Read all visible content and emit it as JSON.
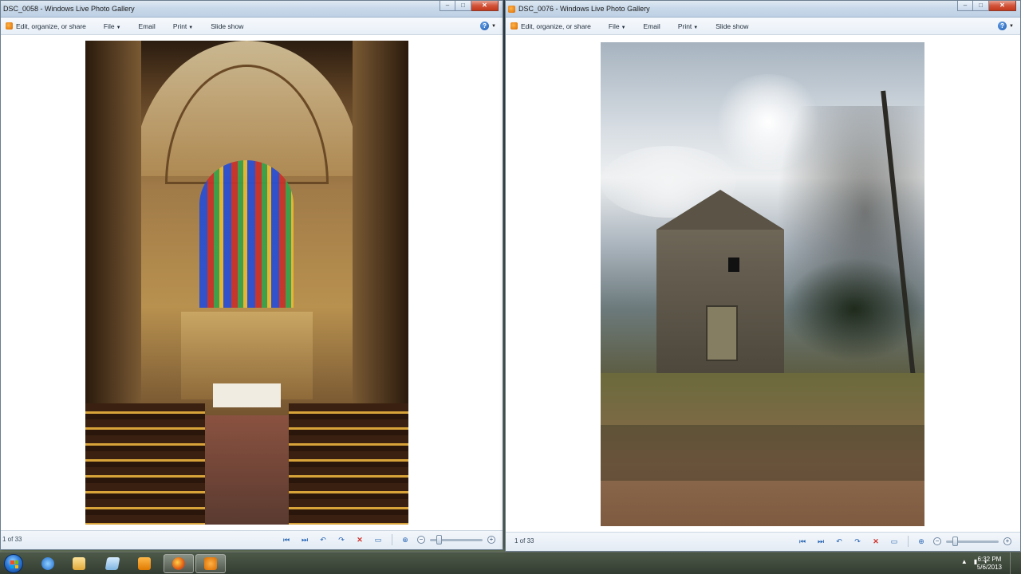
{
  "windows": [
    {
      "title": "DSC_0058 - Windows Live Photo Gallery",
      "menu": {
        "edit": "Edit, organize, or share",
        "file": "File",
        "email": "Email",
        "print": "Print",
        "slideshow": "Slide show"
      },
      "page_count": "1 of 33",
      "photo": "cathedral-interior"
    },
    {
      "title": "DSC_0076 - Windows Live Photo Gallery",
      "menu": {
        "edit": "Edit, organize, or share",
        "file": "File",
        "email": "Email",
        "print": "Print",
        "slideshow": "Slide show"
      },
      "page_count": "1 of 33",
      "photo": "abandoned-barn"
    }
  ],
  "taskbar": {
    "apps": [
      "internet-explorer-icon",
      "windows-explorer-icon",
      "notepad-icon",
      "media-player-icon",
      "firefox-icon",
      "photo-gallery-icon"
    ],
    "clock_time": "6:32 PM",
    "clock_date": "5/6/2013"
  },
  "colors": {
    "titlebar": "#c9d9ea",
    "accent": "#2462b3",
    "close": "#c2391d"
  }
}
